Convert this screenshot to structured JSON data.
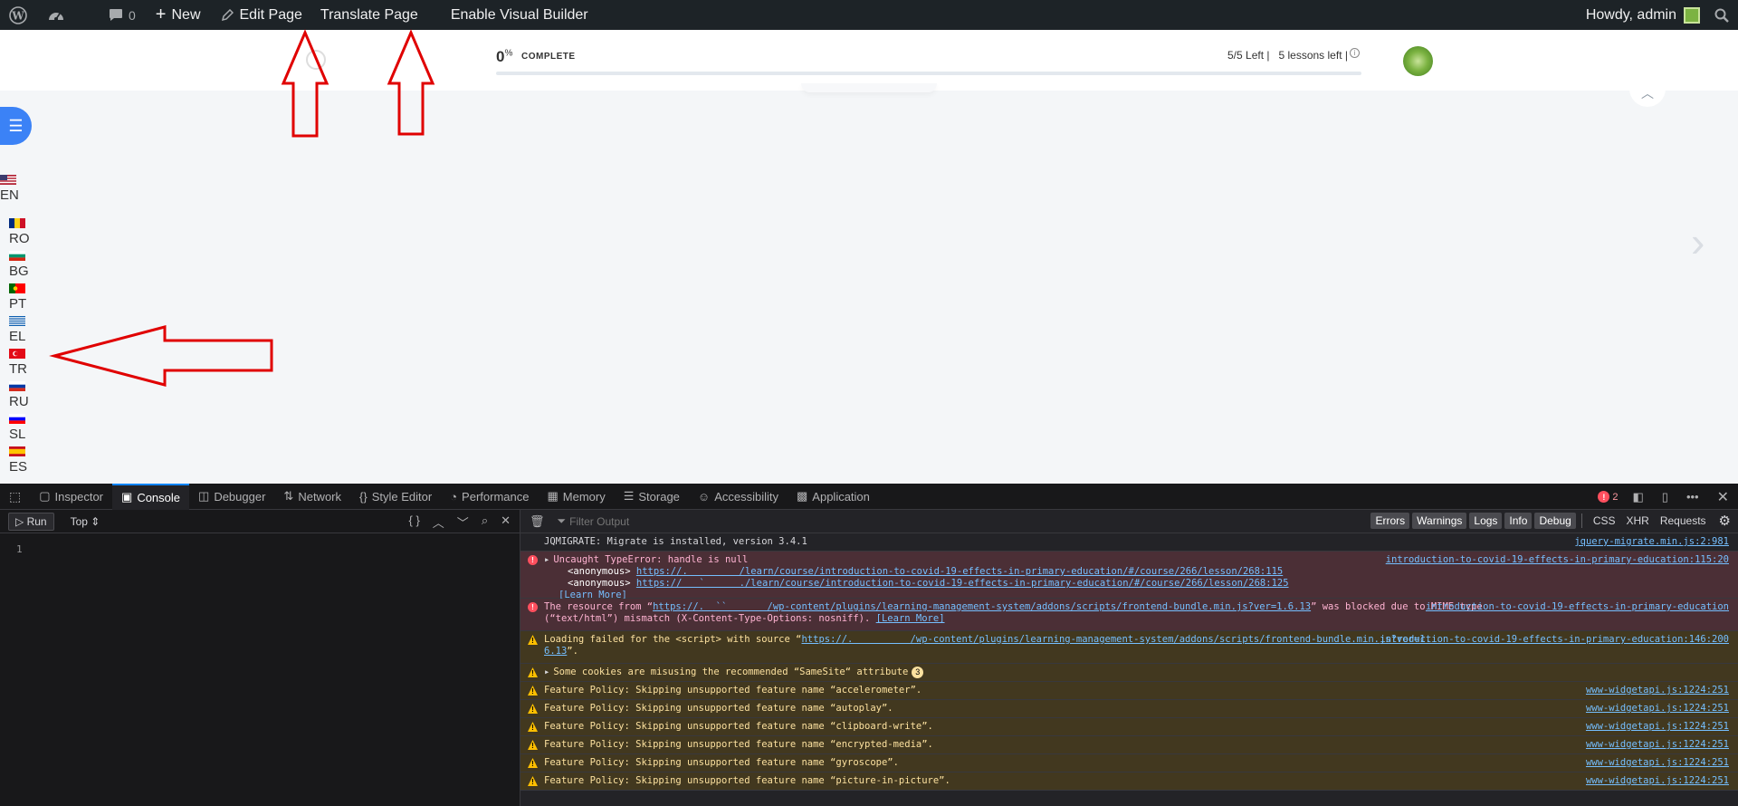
{
  "admin_bar": {
    "comments_count": "0",
    "new_label": "New",
    "edit_label": "Edit Page",
    "translate_label": "Translate Page",
    "visual_builder_label": "Enable Visual Builder",
    "howdy_label": "Howdy, admin"
  },
  "course_header": {
    "progress_value": "0",
    "progress_unit": "%",
    "progress_word": "COMPLETE",
    "progress_fraction": 0,
    "lessons_info": "5/5 Left |   5 lessons left |"
  },
  "languages": [
    {
      "code": "EN",
      "flag": "flag-us-icon"
    },
    {
      "code": "RO",
      "flag": "flag-ro-icon"
    },
    {
      "code": "BG",
      "flag": "flag-bg-icon"
    },
    {
      "code": "PT",
      "flag": "flag-pt-icon"
    },
    {
      "code": "EL",
      "flag": "flag-gr-icon"
    },
    {
      "code": "TR",
      "flag": "flag-tr-icon"
    },
    {
      "code": "RU",
      "flag": "flag-ru-icon"
    },
    {
      "code": "SL",
      "flag": "flag-si-icon"
    },
    {
      "code": "ES",
      "flag": "flag-es-icon"
    }
  ],
  "devtools": {
    "tabs": [
      "Inspector",
      "Console",
      "Debugger",
      "Network",
      "Style Editor",
      "Performance",
      "Memory",
      "Storage",
      "Accessibility",
      "Application"
    ],
    "active_tab": "Console",
    "error_count": "2",
    "editor": {
      "run_label": "Run",
      "context_label": "Top ⇕",
      "line_number": "1",
      "braces_label": "{ }"
    },
    "output": {
      "filter_placeholder": "Filter Output",
      "filters": [
        "Errors",
        "Warnings",
        "Logs",
        "Info",
        "Debug"
      ],
      "secondary_filters": [
        "CSS",
        "XHR",
        "Requests"
      ],
      "messages": [
        {
          "level": "log",
          "text": "JQMIGRATE: Migrate is installed, version 3.4.1",
          "source": "jquery-migrate.min.js:2:981"
        },
        {
          "level": "err",
          "text": "Uncaught TypeError: handle is null",
          "source": "introduction-to-covid-19-effects-in-primary-education:115:20",
          "sub1_fn": "<anonymous>",
          "sub1_url": "https://.         /learn/course/introduction-to-covid-19-effects-in-primary-education/#/course/266/lesson/268:115",
          "sub2_fn": "<anonymous>",
          "sub2_url": "https://   `      ./learn/course/introduction-to-covid-19-effects-in-primary-education/#/course/266/lesson/268:125",
          "learn_more": "[Learn More]"
        },
        {
          "level": "err",
          "text_a": "The resource from “",
          "url": "https://.  ``       /wp-content/plugins/learning-management-system/addons/scripts/frontend-bundle.min.js?ver=1.6.13",
          "text_b": "” was blocked due to MIME type",
          "text_c": "(“text/html”) mismatch (X-Content-Type-Options: nosniff). ",
          "learn_more": "[Learn More]",
          "source": "introduction-to-covid-19-effects-in-primary-education"
        },
        {
          "level": "warn",
          "text_a": "Loading failed for the <script> with source “",
          "url": "https://.          /wp-content/plugins/learning-management-system/addons/scripts/frontend-bundle.min.js?ver=1.",
          "url2": "6.13",
          "text_b": "”.",
          "source": "introduction-to-covid-19-effects-in-primary-education:146:200"
        },
        {
          "level": "warn",
          "text": "Some cookies are misusing the recommended “SameSite“ attribute",
          "count": "3"
        },
        {
          "level": "warn",
          "text": "Feature Policy: Skipping unsupported feature name “accelerometer”.",
          "source": "www-widgetapi.js:1224:251"
        },
        {
          "level": "warn",
          "text": "Feature Policy: Skipping unsupported feature name “autoplay”.",
          "source": "www-widgetapi.js:1224:251"
        },
        {
          "level": "warn",
          "text": "Feature Policy: Skipping unsupported feature name “clipboard-write”.",
          "source": "www-widgetapi.js:1224:251"
        },
        {
          "level": "warn",
          "text": "Feature Policy: Skipping unsupported feature name “encrypted-media”.",
          "source": "www-widgetapi.js:1224:251"
        },
        {
          "level": "warn",
          "text": "Feature Policy: Skipping unsupported feature name “gyroscope”.",
          "source": "www-widgetapi.js:1224:251"
        },
        {
          "level": "warn",
          "text": "Feature Policy: Skipping unsupported feature name “picture-in-picture”.",
          "source": "www-widgetapi.js:1224:251"
        }
      ]
    }
  },
  "colors": {
    "admin_bar_bg": "#1d2327",
    "accent_blue": "#3b82f6",
    "annotation_red": "#e00000",
    "devtools_bg": "#232327",
    "error_bg": "#4b2f36",
    "warning_bg": "#42381f"
  }
}
